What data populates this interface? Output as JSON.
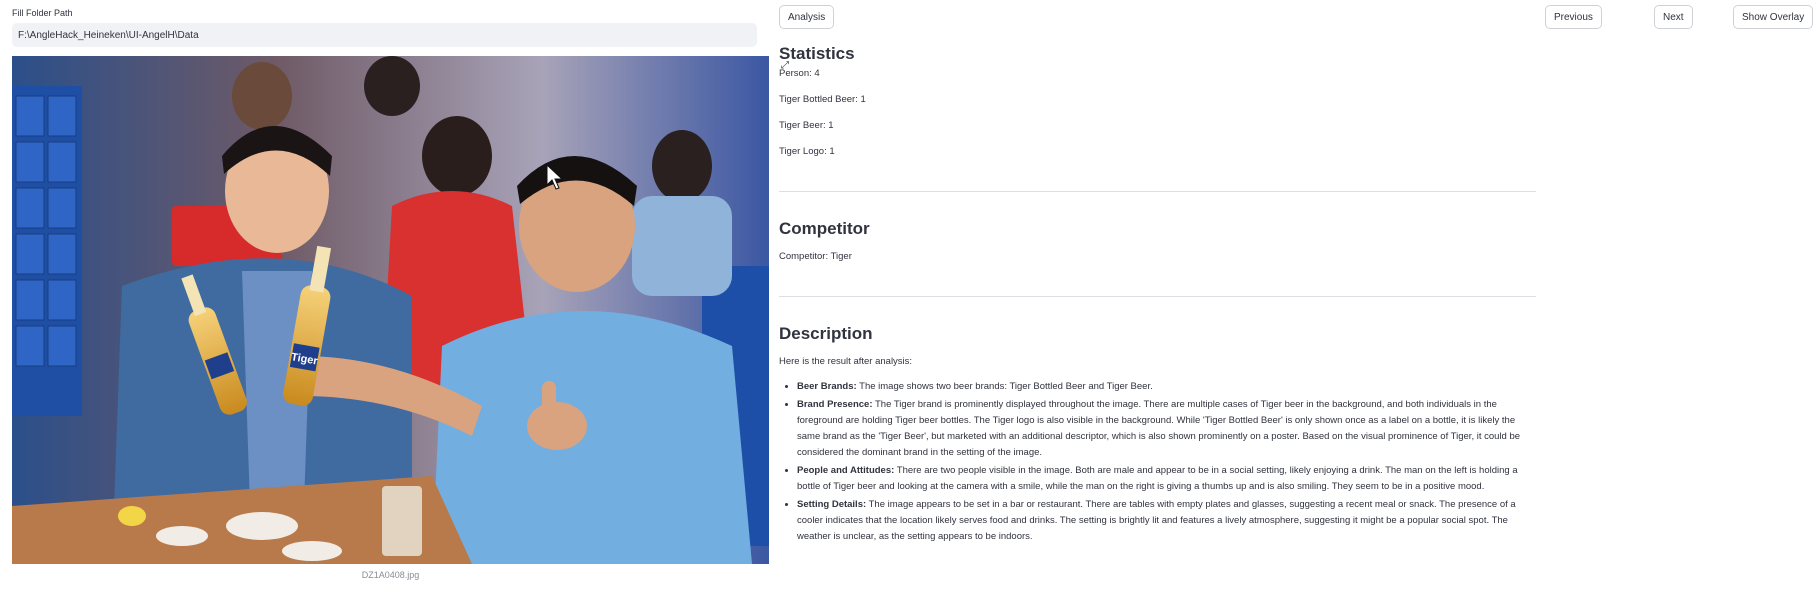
{
  "folder": {
    "label": "Fill Folder Path",
    "value": "F:\\AngleHack_Heineken\\UI-AngelH\\Data"
  },
  "image": {
    "caption": "DZ1A0408.jpg",
    "bottle_label": "Tiger"
  },
  "toolbar": {
    "analysis_label": "Analysis",
    "previous_label": "Previous",
    "next_label": "Next",
    "overlay_label": "Show Overlay"
  },
  "statistics": {
    "title": "Statistics",
    "items": [
      "Person: 4",
      "Tiger Bottled Beer: 1",
      "Tiger Beer: 1",
      "Tiger Logo: 1"
    ]
  },
  "competitor": {
    "title": "Competitor",
    "text": "Competitor: Tiger"
  },
  "description": {
    "title": "Description",
    "intro": "Here is the result after analysis:",
    "items": [
      {
        "heading": "Beer Brands:",
        "text": " The image shows two beer brands: Tiger Bottled Beer and Tiger Beer."
      },
      {
        "heading": "Brand Presence:",
        "text": " The Tiger brand is prominently displayed throughout the image. There are multiple cases of Tiger beer in the background, and both individuals in the foreground are holding Tiger beer bottles. The Tiger logo is also visible in the background. While 'Tiger Bottled Beer' is only shown once as a label on a bottle, it is likely the same brand as the 'Tiger Beer', but marketed with an additional descriptor, which is also shown prominently on a poster. Based on the visual prominence of Tiger, it could be considered the dominant brand in the setting of the image."
      },
      {
        "heading": "People and Attitudes:",
        "text": " There are two people visible in the image. Both are male and appear to be in a social setting, likely enjoying a drink. The man on the left is holding a bottle of Tiger beer and looking at the camera with a smile, while the man on the right is giving a thumbs up and is also smiling. They seem to be in a positive mood."
      },
      {
        "heading": "Setting Details:",
        "text": " The image appears to be set in a bar or restaurant. There are tables with empty plates and glasses, suggesting a recent meal or snack. The presence of a cooler indicates that the location likely serves food and drinks. The setting is brightly lit and features a lively atmosphere, suggesting it might be a popular social spot. The weather is unclear, as the setting appears to be indoors."
      }
    ]
  },
  "colors": {
    "page_bg": "#ffffff",
    "input_bg": "#f0f2f6",
    "text": "#31333f",
    "divider": "#dcdee3"
  }
}
